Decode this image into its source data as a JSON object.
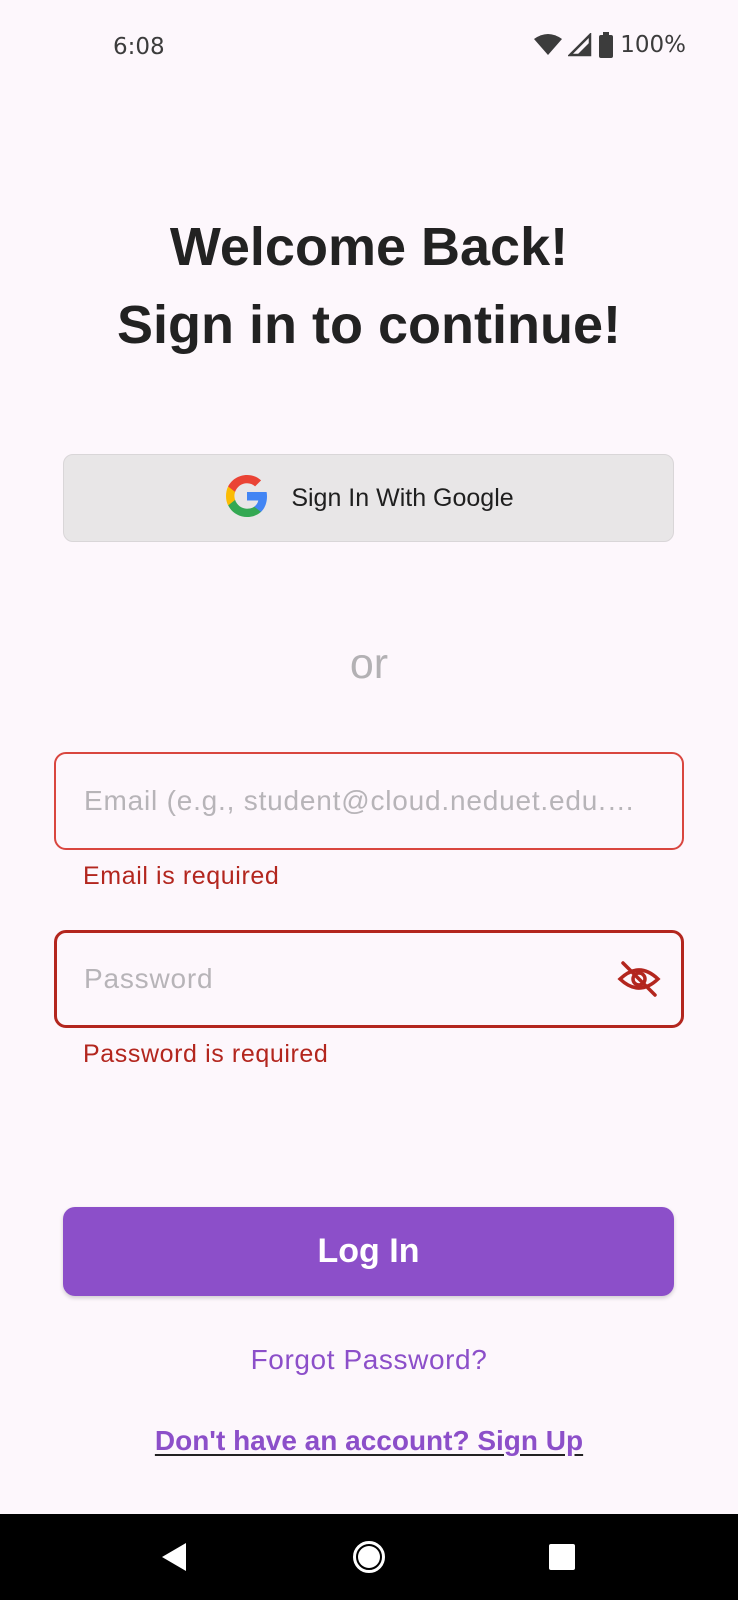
{
  "status_bar": {
    "time": "6:08",
    "battery": "100%",
    "icons": [
      "wifi-icon",
      "signal-icon",
      "battery-icon"
    ]
  },
  "header": {
    "line1": "Welcome Back!",
    "line2": "Sign in to continue!"
  },
  "google_button": {
    "label": "Sign In With Google",
    "icon": "google-icon"
  },
  "divider": {
    "text": "or"
  },
  "form": {
    "email": {
      "value": "",
      "placeholder": "Email (e.g., student@cloud.neduet.edu.pk)",
      "error": "Email is required"
    },
    "password": {
      "value": "",
      "placeholder": "Password",
      "error": "Password is required",
      "toggle_icon": "eye-off-icon"
    }
  },
  "actions": {
    "login_label": "Log In",
    "forgot_label": "Forgot Password?",
    "signup_label": "Don't have an account? Sign Up"
  },
  "colors": {
    "accent": "#8c4fc9",
    "error": "#b3261e",
    "background": "#fdf7fc"
  },
  "nav_bar": {
    "icons": [
      "back-icon",
      "home-icon",
      "recents-icon"
    ]
  }
}
